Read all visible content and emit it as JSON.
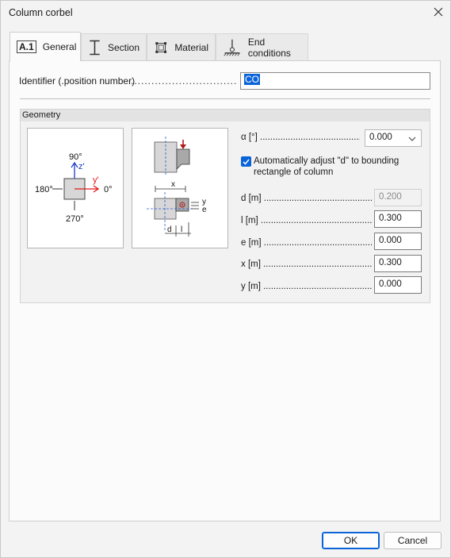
{
  "window": {
    "title": "Column corbel"
  },
  "tabs": [
    {
      "label": "General",
      "icon_text": "A.1"
    },
    {
      "label": "Section"
    },
    {
      "label": "Material"
    },
    {
      "label": "End conditions"
    }
  ],
  "identifier": {
    "label": "Identifier (.position number)",
    "dots": "...............................................",
    "value": "CO"
  },
  "geometry": {
    "label": "Geometry",
    "diagram1": {
      "angle_90": "90°",
      "angle_180": "180°",
      "angle_0": "0°",
      "angle_270": "270°",
      "axis_z": "z'",
      "axis_y": "y'"
    },
    "diagram2": {
      "x": "x",
      "y": "y",
      "e": "e",
      "d": "d",
      "l": "l"
    }
  },
  "properties": {
    "alpha": {
      "label": "α [°] .........................................",
      "value": "0.000"
    },
    "auto_adjust": {
      "label": "Automatically adjust \"d\" to bounding rectangle of column",
      "checked": true
    },
    "d": {
      "label": "d [m] ..............................................",
      "value": "0.200"
    },
    "l": {
      "label": "l [m] ...............................................",
      "value": "0.300"
    },
    "e": {
      "label": "e [m] ..............................................",
      "value": "0.000"
    },
    "x": {
      "label": "x [m] ..............................................",
      "value": "0.300"
    },
    "y": {
      "label": "y [m] ..............................................",
      "value": "0.000"
    }
  },
  "buttons": {
    "ok": "OK",
    "cancel": "Cancel"
  },
  "colors": {
    "accent": "#0a64d8",
    "load_arrow": "#b01818",
    "axis_blue": "#1a3cc8",
    "axis_red": "#e01818"
  }
}
